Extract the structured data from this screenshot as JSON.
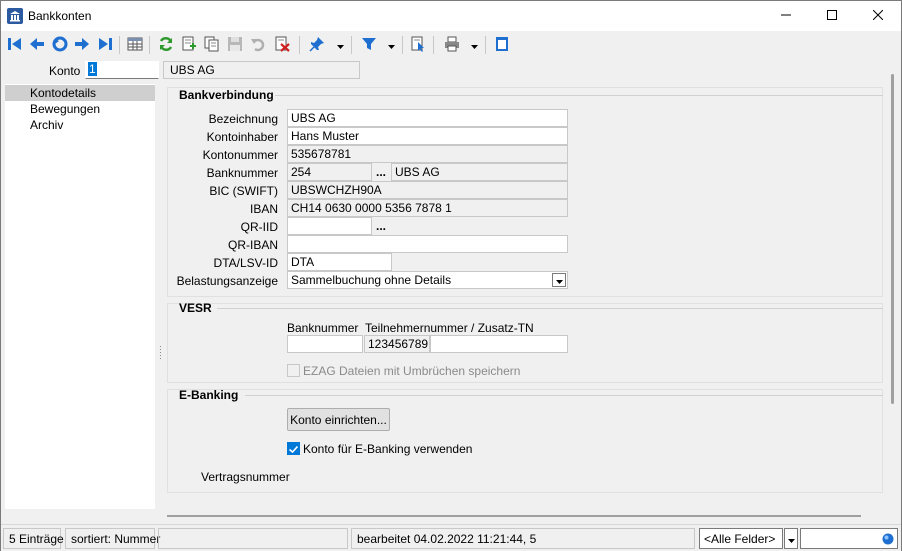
{
  "window": {
    "title": "Bankkonten",
    "icons": [
      "bank-icon",
      "minimize-icon",
      "maximize-icon",
      "close-icon"
    ]
  },
  "toolbar": {
    "icons": [
      "first-record-icon",
      "previous-record-icon",
      "goto-record-icon",
      "next-record-icon",
      "last-record-icon",
      "table-view-icon",
      "refresh-icon",
      "new-record-icon",
      "copy-record-icon",
      "save-icon",
      "undo-icon",
      "delete-icon",
      "pin-icon",
      "filter-icon",
      "document-pointer-icon",
      "print-icon",
      "window-icon"
    ]
  },
  "header": {
    "konto_label": "Konto",
    "konto_value": "1",
    "konto_name": "UBS AG"
  },
  "nav": {
    "items": [
      {
        "label": "Kontodetails",
        "active": true
      },
      {
        "label": "Bewegungen",
        "active": false
      },
      {
        "label": "Archiv",
        "active": false
      }
    ]
  },
  "bankverbindung": {
    "title": "Bankverbindung",
    "bezeichnung_label": "Bezeichnung",
    "bezeichnung_value": "UBS AG",
    "kontoinhaber_label": "Kontoinhaber",
    "kontoinhaber_value": "Hans Muster",
    "kontonummer_label": "Kontonummer",
    "kontonummer_value": "535678781",
    "banknummer_label": "Banknummer",
    "banknummer_value": "254",
    "banknummer_bank": "UBS AG",
    "bic_label": "BIC (SWIFT)",
    "bic_value": "UBSWCHZH90A",
    "iban_label": "IBAN",
    "iban_value": "CH14 0630 0000 5356 7878 1",
    "qriid_label": "QR-IID",
    "qriid_value": "",
    "qriban_label": "QR-IBAN",
    "qriban_value": "",
    "dta_label": "DTA/LSV-ID",
    "dta_value": "DTA",
    "belastung_label": "Belastungsanzeige",
    "belastung_value": "Sammelbuchung ohne Details",
    "dots": "..."
  },
  "vesr": {
    "title": "VESR",
    "banknummer_header": "Banknummer",
    "teilnehmer_header": "Teilnehmernummer / Zusatz-TN",
    "banknummer_value": "",
    "teilnehmer_value": "123456789",
    "zusatz_value": "",
    "ezag_label": "EZAG Dateien mit Umbrüchen speichern"
  },
  "ebanking": {
    "title": "E-Banking",
    "setup_button": "Konto einrichten...",
    "use_label": "Konto für E-Banking verwenden",
    "vertrag_label": "Vertragsnummer"
  },
  "status": {
    "count": "5 Einträge",
    "sort": "sortiert: Nummer",
    "empty": "",
    "edited": "bearbeitet 04.02.2022 11:21:44,  5",
    "field_filter": "<Alle Felder>"
  },
  "colors": {
    "accent": "#0078d7",
    "nav_active": "#cfcfcf"
  }
}
